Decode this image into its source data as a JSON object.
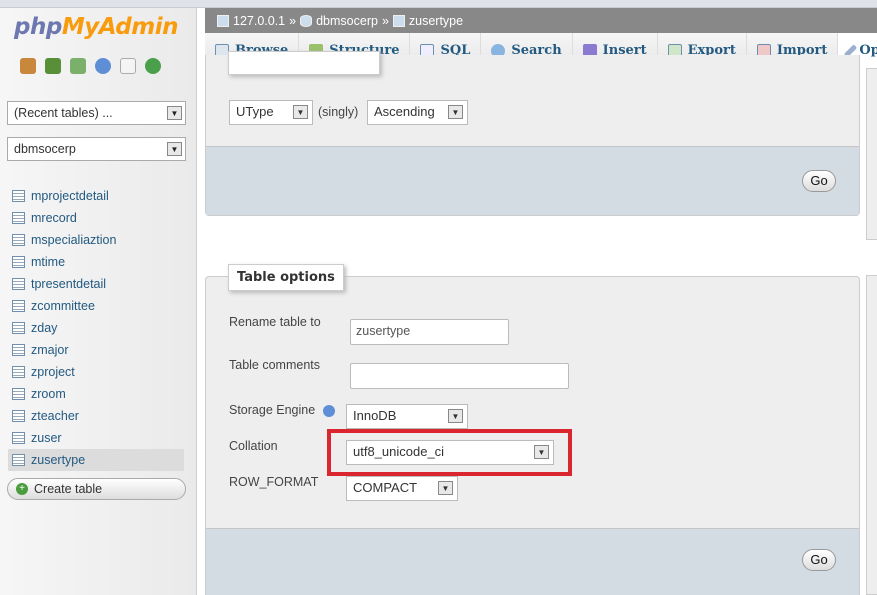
{
  "sidebar": {
    "logo_php": "php",
    "logo_myadmin": "MyAdmin",
    "recent_tables": "(Recent tables) ...",
    "database": "dbmsocerp",
    "tables": [
      "mprojectdetail",
      "mrecord",
      "mspecialiaztion",
      "mtime",
      "tpresentdetail",
      "zcommittee",
      "zday",
      "zmajor",
      "zproject",
      "zroom",
      "zteacher",
      "zuser",
      "zusertype"
    ],
    "active_table": "zusertype",
    "create_table": "Create table"
  },
  "breadcrumb": {
    "server": "127.0.0.1",
    "sep": "»",
    "database": "dbmsocerp",
    "table": "zusertype"
  },
  "tabs": [
    {
      "label": "Browse",
      "icon": "browse-icon"
    },
    {
      "label": "Structure",
      "icon": "structure-icon"
    },
    {
      "label": "SQL",
      "icon": "sql-icon"
    },
    {
      "label": "Search",
      "icon": "search-icon"
    },
    {
      "label": "Insert",
      "icon": "insert-icon"
    },
    {
      "label": "Export",
      "icon": "export-icon"
    },
    {
      "label": "Import",
      "icon": "import-icon"
    },
    {
      "label": "Ope",
      "icon": "wrench-icon"
    }
  ],
  "alter_order": {
    "column": "UType",
    "singly": "(singly)",
    "order": "Ascending",
    "go": "Go"
  },
  "table_options": {
    "legend": "Table options",
    "rename_label": "Rename table to",
    "rename_value": "zusertype",
    "comments_label": "Table comments",
    "comments_value": "",
    "engine_label": "Storage Engine",
    "engine_value": "InnoDB",
    "collation_label": "Collation",
    "collation_value": "utf8_unicode_ci",
    "row_format_label": "ROW_FORMAT",
    "row_format_value": "COMPACT",
    "go": "Go"
  },
  "colors": {
    "highlight": "#d9262f",
    "link": "#235a81",
    "breadcrumb_bg": "#888888"
  }
}
